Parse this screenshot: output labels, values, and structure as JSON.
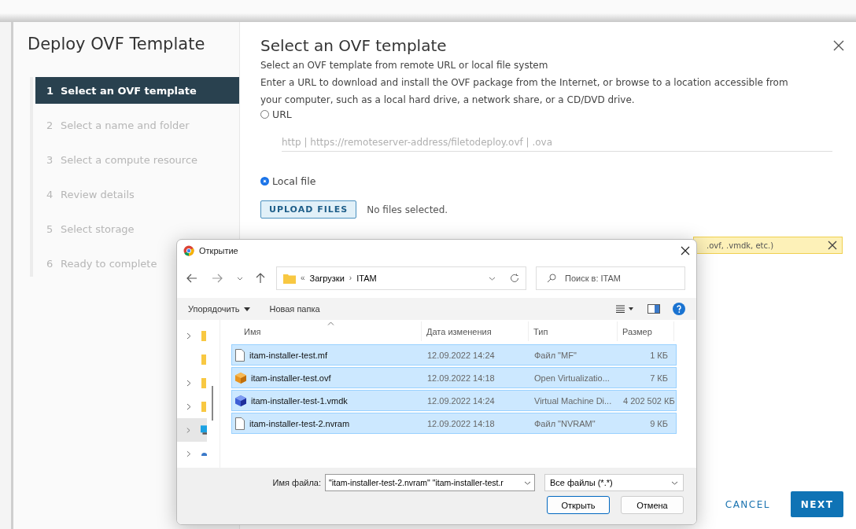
{
  "wizard": {
    "title": "Deploy OVF Template",
    "steps": [
      {
        "number": "1",
        "label": "Select an OVF template",
        "selected": true
      },
      {
        "number": "2",
        "label": "Select a name and folder",
        "selected": false
      },
      {
        "number": "3",
        "label": "Select a compute resource",
        "selected": false
      },
      {
        "number": "4",
        "label": "Review details",
        "selected": false
      },
      {
        "number": "5",
        "label": "Select storage",
        "selected": false
      },
      {
        "number": "6",
        "label": "Ready to complete",
        "selected": false
      }
    ]
  },
  "content": {
    "heading": "Select an OVF template",
    "intro": "Select an OVF template from remote URL or local file system",
    "description": "Enter a URL to download and install the OVF package from the Internet, or browse to a location accessible from your computer, such as a local hard drive, a network share, or a CD/DVD drive.",
    "sources": [
      {
        "label": "URL",
        "selected": false
      },
      {
        "label": "Local file",
        "selected": true
      }
    ],
    "url_field": {
      "placeholder": "http | https://remoteserver-address/filetodeploy.ovf | .ova"
    },
    "upload_button": "UPLOAD FILES",
    "upload_status": "No files selected.",
    "warning": ".ovf, .vmdk, etc.)",
    "buttons": [
      "CANCEL",
      "NEXT"
    ]
  },
  "dialog": {
    "title": "Открытие",
    "breadcrumb": [
      "«",
      "Загрузки",
      "›",
      "ITAM"
    ],
    "search": {
      "placeholder": "Поиск в: ITAM"
    },
    "organize": "Упорядочить",
    "new_folder": "Новая папка",
    "nav_tree": [
      {
        "kind": "folder",
        "expandable": true,
        "selected": false
      },
      {
        "kind": "folder",
        "expandable": false,
        "selected": false
      },
      {
        "kind": "folder",
        "expandable": true,
        "selected": false
      },
      {
        "kind": "folder",
        "expandable": true,
        "selected": false
      },
      {
        "kind": "monitor",
        "expandable": true,
        "selected": true
      },
      {
        "kind": "network",
        "expandable": true,
        "selected": false
      }
    ],
    "columns": [
      "Имя",
      "Дата изменения",
      "Тип",
      "Размер"
    ],
    "rows": [
      {
        "kind": "file",
        "name": "itam-installer-test.mf",
        "date": "12.09.2022 14:24",
        "type": "Файл \"MF\"",
        "size": "1 КБ",
        "selected": true
      },
      {
        "kind": "package",
        "name": "itam-installer-test.ovf",
        "date": "12.09.2022 14:18",
        "type": "Open Virtualizatio...",
        "size": "7 КБ",
        "selected": true
      },
      {
        "kind": "disk",
        "name": "itam-installer-test-1.vmdk",
        "date": "12.09.2022 14:24",
        "type": "Virtual Machine Di...",
        "size": "4 202 502 КБ",
        "selected": true
      },
      {
        "kind": "file",
        "name": "itam-installer-test-2.nvram",
        "date": "12.09.2022 14:18",
        "type": "Файл \"NVRAM\"",
        "size": "9 КБ",
        "selected": true
      }
    ],
    "filename_label": "Имя файла:",
    "filename_value": "\"itam-installer-test-2.nvram\" \"itam-installer-test.r",
    "filter": "Все файлы (*.*)",
    "buttons": [
      "Открыть",
      "Отмена"
    ]
  }
}
